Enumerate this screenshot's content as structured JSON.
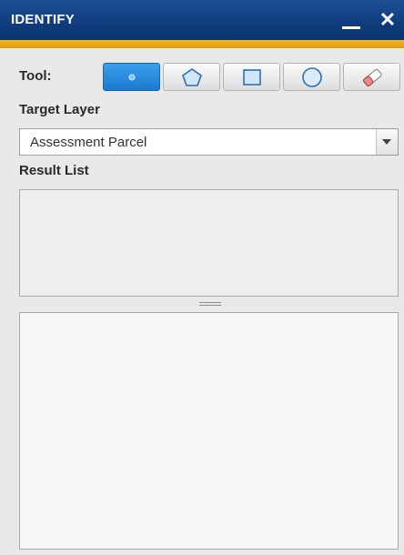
{
  "window": {
    "title": "IDENTIFY",
    "minimize_icon": "minimize-icon",
    "close_icon": "close-icon",
    "colors": {
      "titlebar": "#0f3c7c",
      "accent": "#f0a818",
      "active_tool": "#2a8ee0"
    }
  },
  "tool": {
    "label": "Tool:",
    "buttons": [
      {
        "name": "point",
        "icon": "point-icon",
        "active": true
      },
      {
        "name": "polygon",
        "icon": "polygon-icon",
        "active": false
      },
      {
        "name": "rectangle",
        "icon": "rectangle-icon",
        "active": false
      },
      {
        "name": "circle",
        "icon": "circle-icon",
        "active": false
      },
      {
        "name": "eraser",
        "icon": "eraser-icon",
        "active": false
      }
    ]
  },
  "target_layer": {
    "label": "Target Layer",
    "selected": "Assessment Parcel"
  },
  "result_list": {
    "label": "Result List"
  }
}
